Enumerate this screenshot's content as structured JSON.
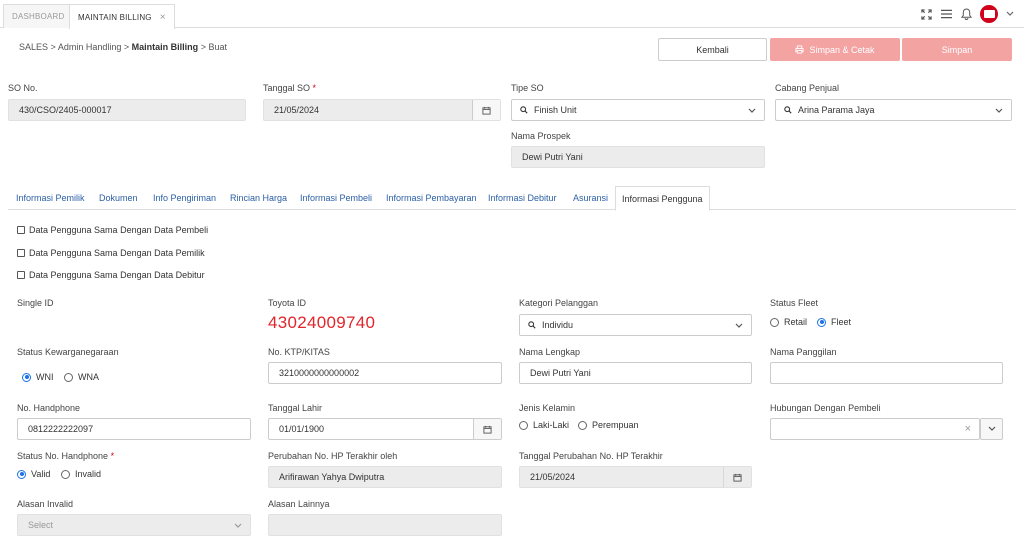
{
  "tabs": [
    {
      "label": "DASHBOARD"
    },
    {
      "label": "MAINTAIN BILLING",
      "close": "×"
    }
  ],
  "breadcrumb": {
    "items": [
      "SALES",
      "Admin Handling",
      "Maintain Billing",
      "Buat"
    ],
    "sep": ">"
  },
  "actions": {
    "kembali": "Kembali",
    "simpan_cetak": "Simpan & Cetak",
    "simpan": "Simpan"
  },
  "so": {
    "so_no_label": "SO No.",
    "so_no_value": "430/CSO/2405-000017",
    "tanggal_so_label": "Tanggal SO",
    "tanggal_so_value": "21/05/2024",
    "tipe_so_label": "Tipe SO",
    "tipe_so_value": "Finish Unit",
    "cabang_label": "Cabang Penjual",
    "cabang_value": "Arina Parama Jaya",
    "prospek_label": "Nama Prospek",
    "prospek_value": "Dewi Putri Yani"
  },
  "section_tabs": [
    "Informasi Pemilik",
    "Dokumen",
    "Info Pengiriman",
    "Rincian Harga",
    "Informasi Pembeli",
    "Informasi Pembayaran",
    "Informasi Debitur",
    "Asuransi",
    "Informasi Pengguna"
  ],
  "checkboxes": [
    "Data Pengguna Sama Dengan Data Pembeli",
    "Data Pengguna Sama Dengan Data Pemilik",
    "Data Pengguna Sama Dengan Data Debitur"
  ],
  "form": {
    "single_id_label": "Single ID",
    "toyota_id_label": "Toyota ID",
    "toyota_id_value": "43024009740",
    "kategori_label": "Kategori Pelanggan",
    "kategori_value": "Individu",
    "status_fleet_label": "Status Fleet",
    "fleet_retail": "Retail",
    "fleet_fleet": "Fleet",
    "kewarganegaraan_label": "Status Kewarganegaraan",
    "wni": "WNI",
    "wna": "WNA",
    "ktp_label": "No. KTP/KITAS",
    "ktp_value": "3210000000000002",
    "nama_lengkap_label": "Nama Lengkap",
    "nama_lengkap_value": "Dewi Putri Yani",
    "nama_panggilan_label": "Nama Panggilan",
    "hp_label": "No. Handphone",
    "hp_value": "0812222222097",
    "tgl_lahir_label": "Tanggal Lahir",
    "tgl_lahir_value": "01/01/1900",
    "jk_label": "Jenis Kelamin",
    "jk_laki": "Laki-Laki",
    "jk_perempuan": "Perempuan",
    "hubungan_label": "Hubungan Dengan Pembeli",
    "hubungan_clear": "×",
    "status_hp_label": "Status No. Handphone",
    "valid": "Valid",
    "invalid": "Invalid",
    "perubahan_label": "Perubahan No. HP Terakhir oleh",
    "perubahan_value": "Arifirawan Yahya Dwiputra",
    "tgl_perubahan_label": "Tanggal Perubahan No. HP Terakhir",
    "tgl_perubahan_value": "21/05/2024",
    "alasan_invalid_label": "Alasan Invalid",
    "alasan_invalid_placeholder": "Select",
    "alasan_lainnya_label": "Alasan Lainnya"
  },
  "colors": {
    "accent": "#1a73e8",
    "brand_red": "#d0021b",
    "button_disabled": "#f4a3a3",
    "link": "#2b5fa5"
  },
  "icons": [
    "expand-icon",
    "menu-icon",
    "bell-icon",
    "user-avatar",
    "chevron-down-icon",
    "search-icon",
    "calendar-icon",
    "printer-icon"
  ]
}
